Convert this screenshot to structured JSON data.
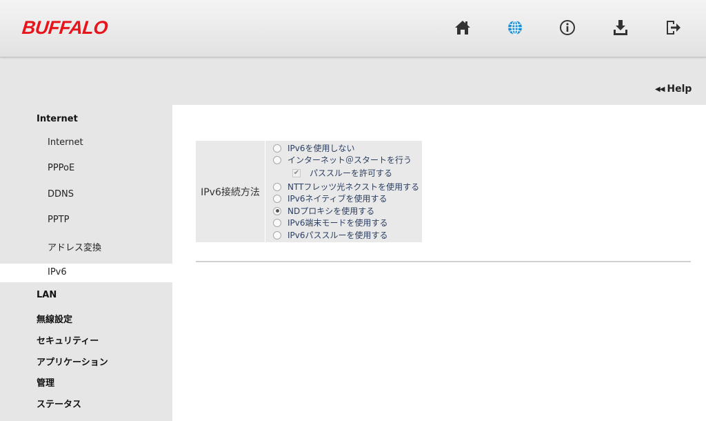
{
  "header": {
    "logo": "BUFFALO",
    "icons": [
      "home-icon",
      "globe-icon",
      "info-icon",
      "download-icon",
      "logout-icon"
    ],
    "active_icon": "globe-icon",
    "brand_color": "#e8141b",
    "active_color": "#1a8fd9"
  },
  "help": {
    "label": "Help"
  },
  "sidebar": {
    "internet": "Internet",
    "sub": [
      "Internet",
      "PPPoE",
      "DDNS",
      "PPTP",
      "アドレス変換",
      "IPv6"
    ],
    "active": "IPv6",
    "lan": "LAN",
    "wireless": "無線設定",
    "security": "セキュリティー",
    "application": "アプリケーション",
    "admin": "管理",
    "status": "ステータス"
  },
  "form": {
    "label": "IPv6接続方法",
    "options": [
      "IPv6を使用しない",
      "インターネット＠スタートを行う",
      "NTTフレッツ光ネクストを使用する",
      "IPv6ネイティブを使用する",
      "NDプロキシを使用する",
      "IPv6端末モードを使用する",
      "IPv6パススルーを使用する"
    ],
    "selected": "NDプロキシを使用する",
    "checkbox_label": "パススルーを許可する",
    "checkbox_checked": true
  }
}
